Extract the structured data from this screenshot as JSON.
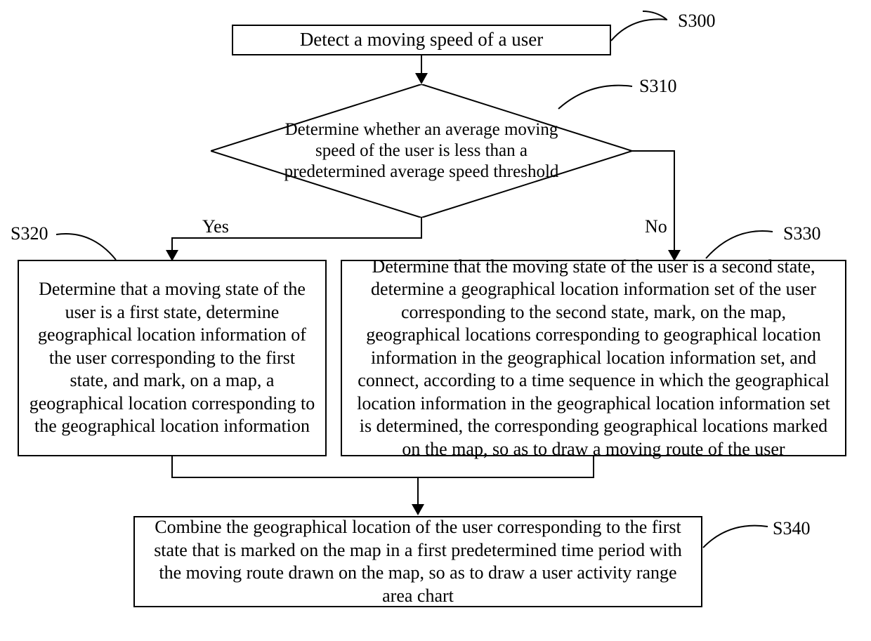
{
  "nodes": {
    "s300": {
      "label": "S300",
      "text": "Detect a moving speed of a user"
    },
    "s310": {
      "label": "S310",
      "text": "Determine whether an average moving speed of the user is less than a predetermined average speed threshold"
    },
    "s320": {
      "label": "S320",
      "text": "Determine that a moving state of the user is a first state, determine geographical location information of the user corresponding to the first state, and mark, on a map, a geographical location corresponding to the geographical location information"
    },
    "s330": {
      "label": "S330",
      "text": "Determine that the moving state of the user is a second state, determine a geographical location information set of the user corresponding to the second state, mark, on the map, geographical locations corresponding to geographical location information in the geographical location information set, and connect, according to a time sequence in which the geographical location information in the geographical location information set is determined, the corresponding geographical locations marked on the map, so as to draw a moving route of the user"
    },
    "s340": {
      "label": "S340",
      "text": "Combine the geographical location of the user corresponding to the first state that is marked on the map in a first predetermined time period with the moving route drawn on the map, so as to draw a user activity range area chart"
    }
  },
  "edges": {
    "yes": "Yes",
    "no": "No"
  }
}
